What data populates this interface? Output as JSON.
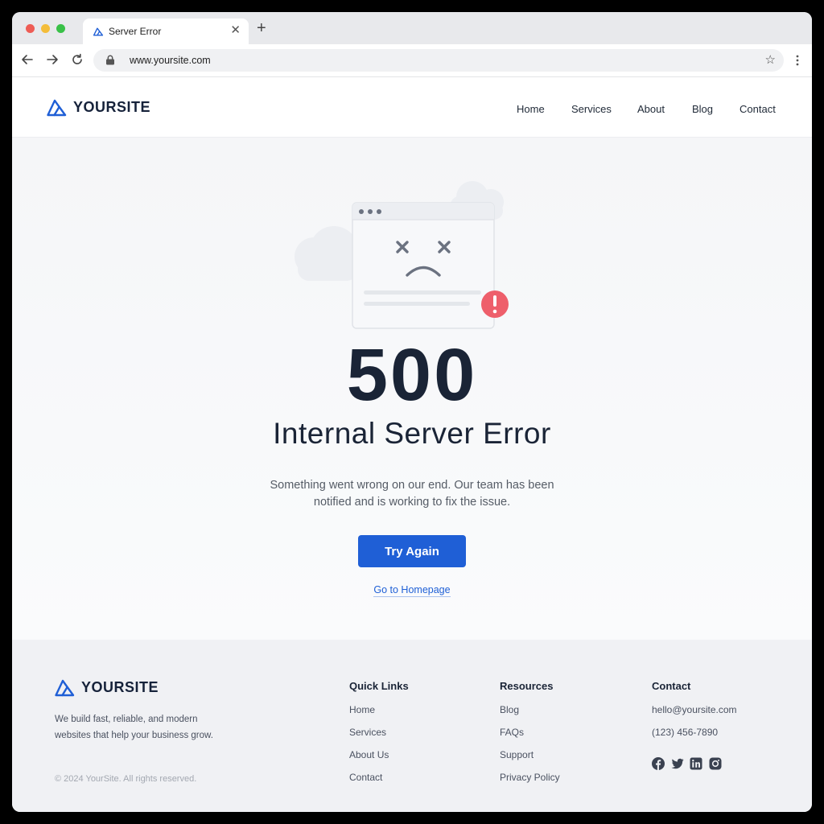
{
  "browser": {
    "tab_title": "Server Error",
    "tab_close": "✕",
    "new_tab": "+",
    "url": "www.yoursite.com",
    "bookmark_star": "☆"
  },
  "header": {
    "brand": "YOURSITE",
    "nav": [
      "Home",
      "Services",
      "About",
      "Blog",
      "Contact"
    ]
  },
  "error": {
    "code": "500",
    "title": "Internal Server Error",
    "message": "Something went wrong on our end. Our team has been notified and is working to fix the issue.",
    "retry_label": "Try Again",
    "home_link": "Go to Homepage"
  },
  "footer": {
    "brand": "YOURSITE",
    "tagline": "We build fast, reliable, and modern websites that help your business grow.",
    "copyright": "© 2024 YourSite. All rights reserved.",
    "quick_links": {
      "title": "Quick Links",
      "items": [
        "Home",
        "Services",
        "About Us",
        "Contact"
      ]
    },
    "resources": {
      "title": "Resources",
      "items": [
        "Blog",
        "FAQs",
        "Support",
        "Privacy Policy"
      ]
    },
    "contact": {
      "title": "Contact",
      "email": "hello@yoursite.com",
      "phone": "(123) 456-7890",
      "socials": [
        "facebook-icon",
        "twitter-icon",
        "linkedin-icon",
        "instagram-icon"
      ]
    }
  },
  "colors": {
    "accent": "#1f5fd6",
    "heading": "#1a2436",
    "alert": "#ee5f6b"
  }
}
